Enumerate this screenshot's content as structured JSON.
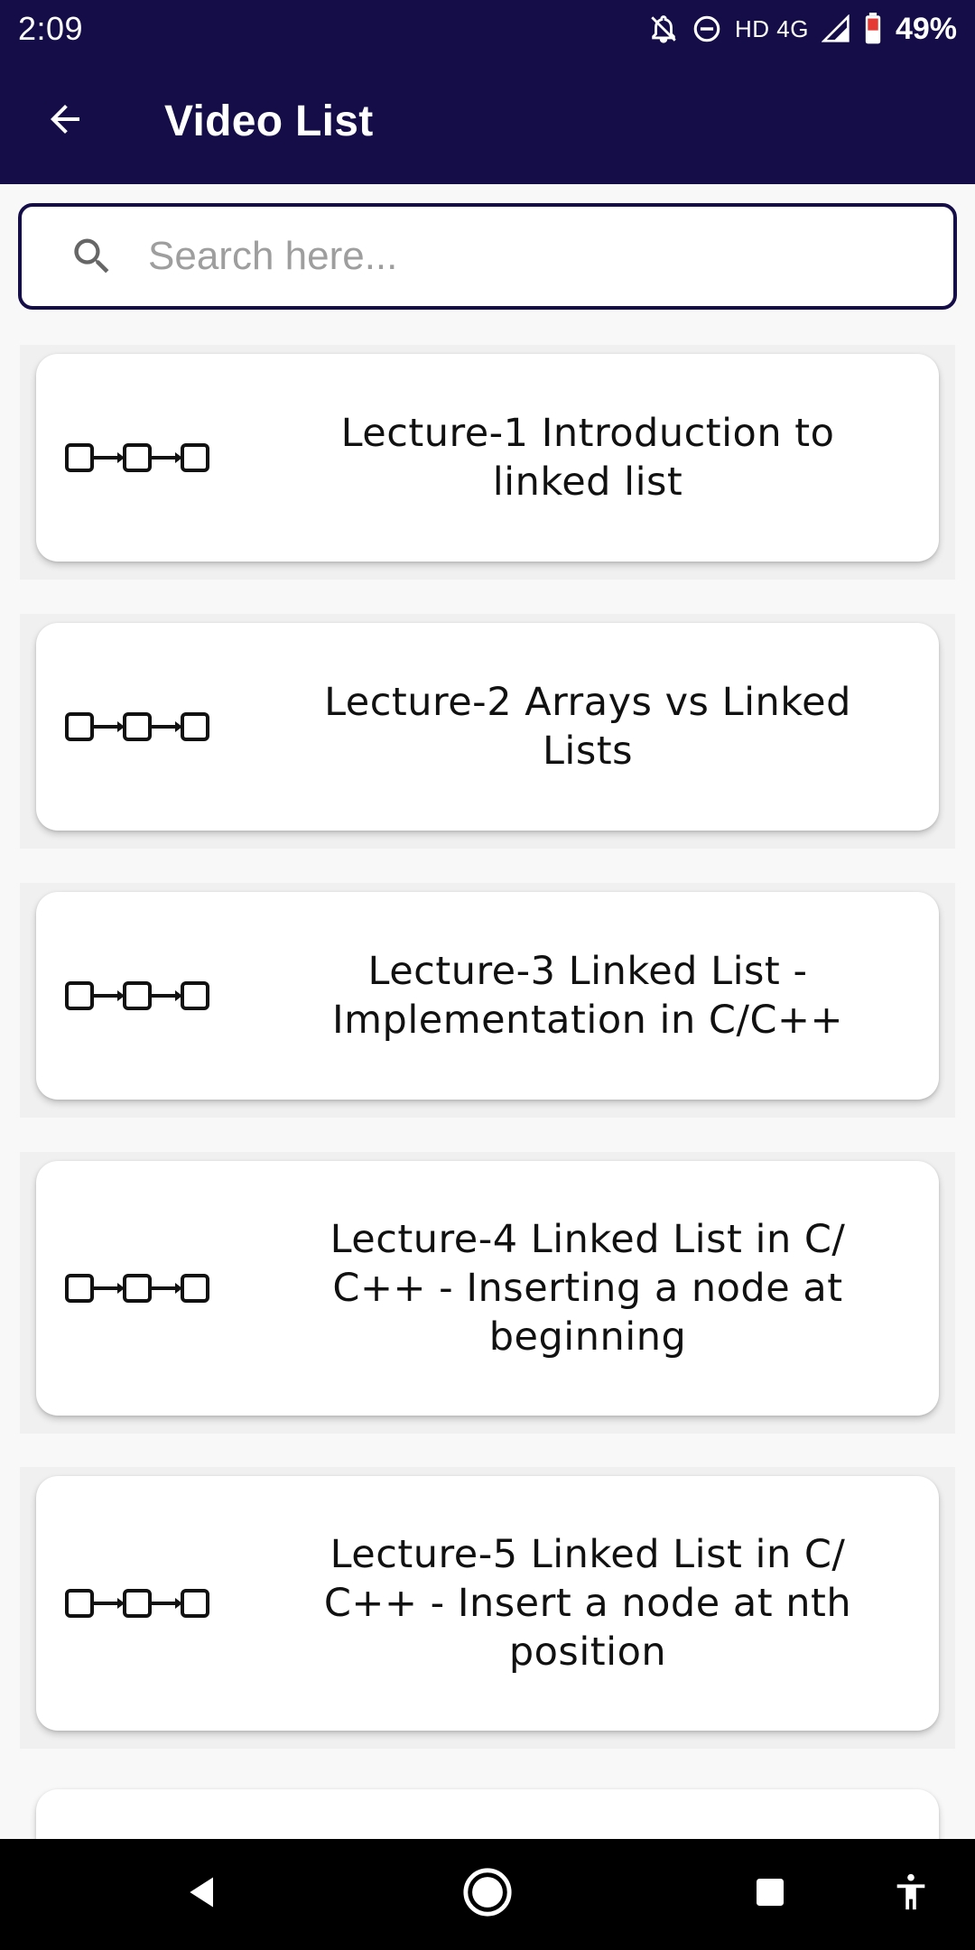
{
  "status_bar": {
    "time": "2:09",
    "network": "HD 4G",
    "battery": "49%"
  },
  "app_bar": {
    "title": "Video List",
    "back_icon": "arrow-left-icon"
  },
  "search": {
    "placeholder": "Search here...",
    "value": "",
    "icon": "search-icon"
  },
  "videos": [
    {
      "title": "Lecture-1 Introduction to linked list",
      "icon": "linked-list-icon"
    },
    {
      "title": "Lecture-2 Arrays vs Linked Lists",
      "icon": "linked-list-icon"
    },
    {
      "title": "Lecture-3 Linked List - Implementation in C/C++",
      "icon": "linked-list-icon"
    },
    {
      "title": "Lecture-4 Linked List in C/ C++ - Inserting a node at beginning",
      "icon": "linked-list-icon"
    },
    {
      "title": "Lecture-5 Linked List in C/ C++ - Insert a node at nth position",
      "icon": "linked-list-icon"
    },
    {
      "title": "",
      "icon": "linked-list-icon"
    }
  ],
  "nav_bar": {
    "back": "nav-back-icon",
    "home": "nav-home-icon",
    "recents": "nav-recents-icon",
    "accessibility": "accessibility-icon"
  },
  "colors": {
    "primary": "#150d48",
    "card": "#ffffff",
    "background": "#f8f8f8"
  }
}
